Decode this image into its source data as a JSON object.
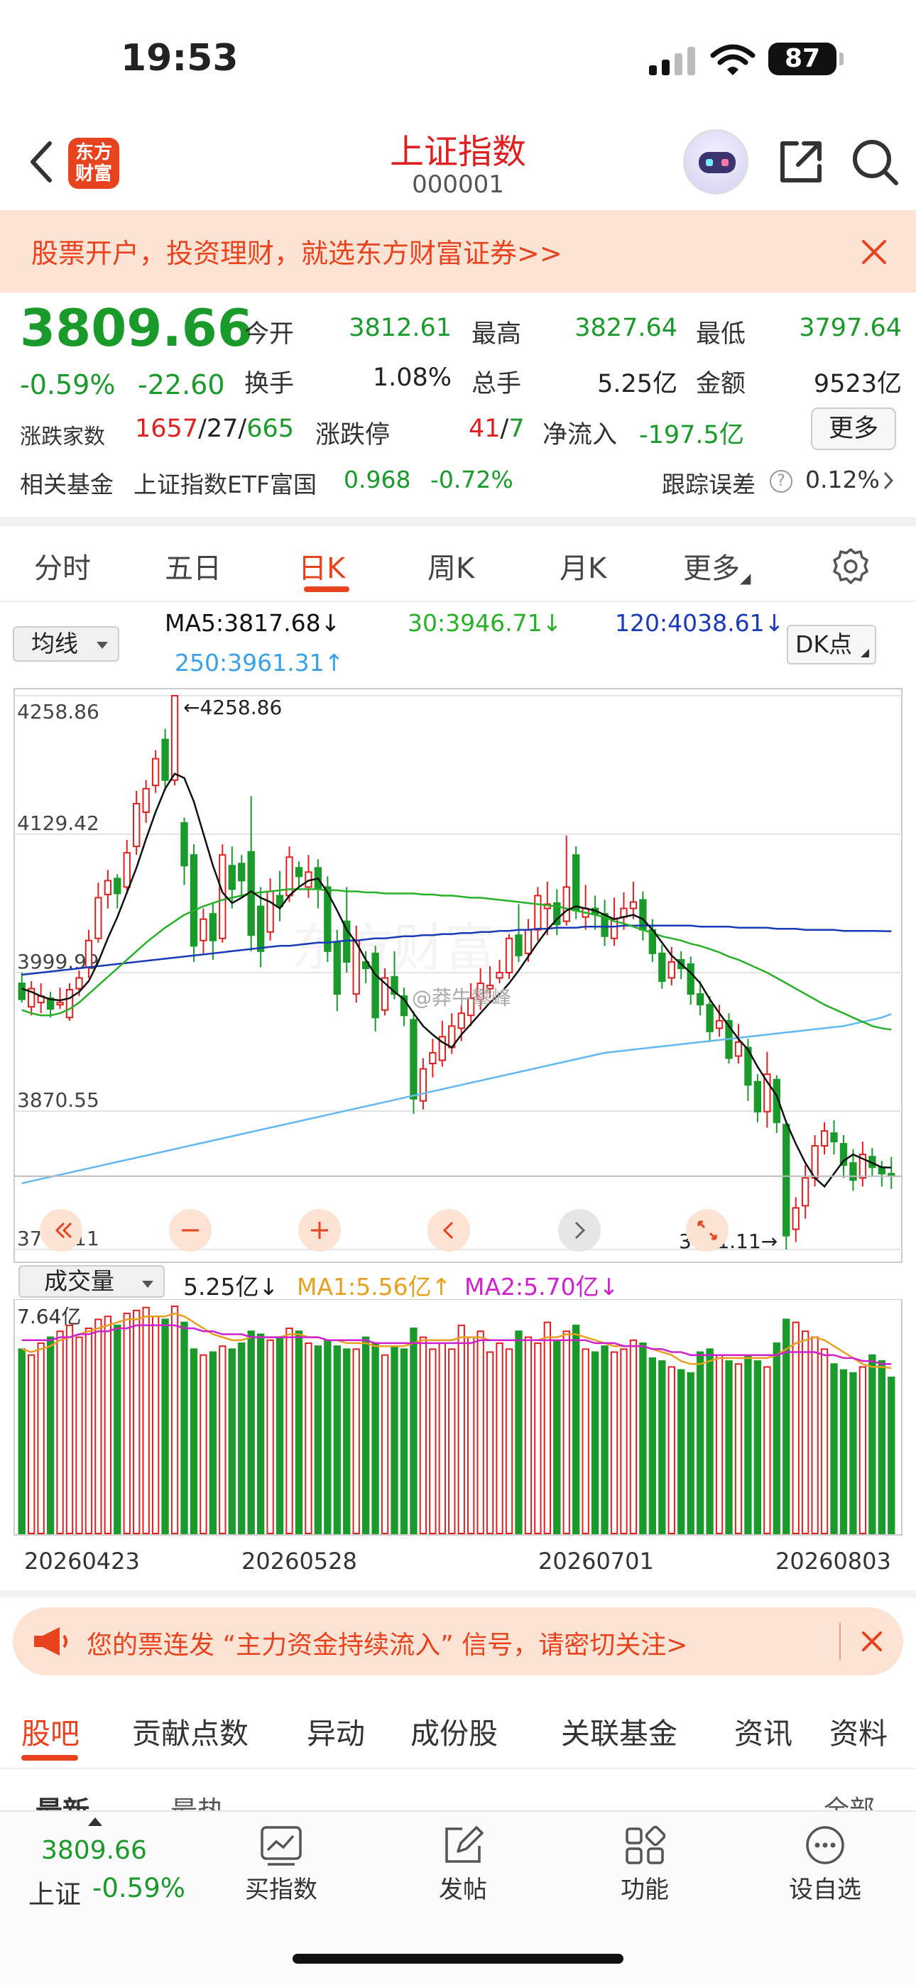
{
  "status": {
    "time": "19:53",
    "battery": "87"
  },
  "header": {
    "logo": "东方财富",
    "logo_line1": "东方",
    "logo_line2": "财富",
    "title": "上证指数",
    "code": "000001"
  },
  "promo": {
    "text": "股票开户，投资理财，就选东方财富证券>>"
  },
  "quote": {
    "price": "3809.66",
    "change_pct": "-0.59%",
    "change": "-22.60",
    "open_label": "今开",
    "open": "3812.61",
    "high_label": "最高",
    "high": "3827.64",
    "low_label": "最低",
    "low": "3797.64",
    "turnover_label": "换手",
    "turnover": "1.08%",
    "volume_label": "总手",
    "volume": "5.25亿",
    "amount_label": "金额",
    "amount": "9523亿",
    "breadth_label": "涨跌家数",
    "up_count": "1657",
    "flat_count": "27",
    "down_count": "665",
    "limit_label": "涨跌停",
    "limit_up": "41",
    "limit_down": "7",
    "inflow_label": "净流入",
    "inflow": "-197.5亿",
    "more_label": "更多",
    "fund_label": "相关基金",
    "fund_name": "上证指数ETF富国",
    "fund_price": "0.968",
    "fund_pct": "-0.72%",
    "tracking_label": "跟踪误差",
    "tracking_value": "0.12%"
  },
  "period_tabs": [
    "分时",
    "五日",
    "日K",
    "周K",
    "月K",
    "更多"
  ],
  "active_period": "日K",
  "ma": {
    "select_label": "均线",
    "ma5": "MA5:3817.68↓",
    "ma30": "30:3946.71↓",
    "ma120": "120:4038.61↓",
    "ma250": "250:3961.31↑",
    "dk_label": "DK点"
  },
  "colors": {
    "up": "#e02020",
    "down": "#1a9a2a",
    "ma5": "#111111",
    "ma30": "#28b028",
    "ma120": "#1a3ab8",
    "ma250": "#62b8f0",
    "accent": "#e8431f"
  },
  "chart_data": {
    "type": "candlestick",
    "y_ticks": [
      "4258.86",
      "4129.42",
      "3999.99",
      "3870.55",
      "3741.11"
    ],
    "ylim": [
      3741.11,
      4258.86
    ],
    "max_marker": "←4258.86",
    "min_marker": "3741.11→",
    "candles": [
      [
        3990,
        3975,
        4000,
        3972
      ],
      [
        3968,
        3985,
        3992,
        3960
      ],
      [
        3972,
        3978,
        3990,
        3962
      ],
      [
        3976,
        3966,
        3982,
        3958
      ],
      [
        3970,
        3972,
        3986,
        3966
      ],
      [
        3958,
        3984,
        3990,
        3955
      ],
      [
        3985,
        3995,
        4002,
        3978
      ],
      [
        4005,
        4030,
        4040,
        3995
      ],
      [
        4032,
        4070,
        4084,
        4028
      ],
      [
        4073,
        4086,
        4096,
        4060
      ],
      [
        4088,
        4074,
        4092,
        4060
      ],
      [
        4080,
        4112,
        4124,
        4074
      ],
      [
        4118,
        4158,
        4170,
        4110
      ],
      [
        4150,
        4172,
        4180,
        4140
      ],
      [
        4175,
        4200,
        4208,
        4168
      ],
      [
        4218,
        4180,
        4228,
        4170
      ],
      [
        4180,
        4258.86,
        4258.86,
        4175
      ],
      [
        4140,
        4100,
        4145,
        4082
      ],
      [
        4110,
        4025,
        4120,
        4010
      ],
      [
        4030,
        4050,
        4060,
        4018
      ],
      [
        4055,
        4030,
        4065,
        4012
      ],
      [
        4032,
        4110,
        4120,
        4028
      ],
      [
        4100,
        4078,
        4118,
        4060
      ],
      [
        4102,
        4086,
        4110,
        4070
      ],
      [
        4113,
        4035,
        4165,
        4020
      ],
      [
        4062,
        4020,
        4080,
        4005
      ],
      [
        4038,
        4076,
        4088,
        4030
      ],
      [
        4072,
        4062,
        4095,
        4048
      ],
      [
        4072,
        4108,
        4118,
        4066
      ],
      [
        4098,
        4090,
        4104,
        4080
      ],
      [
        4080,
        4094,
        4110,
        4070
      ],
      [
        4098,
        4078,
        4106,
        4060
      ],
      [
        4080,
        4020,
        4090,
        4010
      ],
      [
        4028,
        3980,
        4040,
        3964
      ],
      [
        4048,
        4010,
        4080,
        4000
      ],
      [
        3980,
        4030,
        4044,
        3972
      ],
      [
        4010,
        4004,
        4020,
        3990
      ],
      [
        4018,
        3958,
        4025,
        3945
      ],
      [
        3965,
        3995,
        4004,
        3960
      ],
      [
        3996,
        3980,
        4020,
        3975
      ],
      [
        3978,
        3960,
        3986,
        3950
      ],
      [
        3956,
        3882,
        3964,
        3868
      ],
      [
        3880,
        3910,
        3920,
        3872
      ],
      [
        3915,
        3925,
        3938,
        3902
      ],
      [
        3918,
        3940,
        3955,
        3912
      ],
      [
        3930,
        3950,
        3962,
        3924
      ],
      [
        3948,
        3962,
        3970,
        3936
      ],
      [
        3960,
        3976,
        3990,
        3950
      ],
      [
        3975,
        3990,
        4004,
        3965
      ],
      [
        3985,
        3988,
        4006,
        3976
      ],
      [
        3995,
        4000,
        4012,
        3990
      ],
      [
        4000,
        4032,
        4036,
        3994
      ],
      [
        4035,
        4016,
        4064,
        4010
      ],
      [
        4018,
        4040,
        4050,
        4010
      ],
      [
        4040,
        4072,
        4080,
        4030
      ],
      [
        4060,
        4064,
        4085,
        4035
      ],
      [
        4065,
        4045,
        4078,
        4035
      ],
      [
        4048,
        4080,
        4128,
        4044
      ],
      [
        4110,
        4058,
        4118,
        4050
      ],
      [
        4052,
        4060,
        4082,
        4040
      ],
      [
        4060,
        4055,
        4072,
        4040
      ],
      [
        4055,
        4034,
        4068,
        4025
      ],
      [
        4032,
        4050,
        4070,
        4025
      ],
      [
        4052,
        4060,
        4075,
        4040
      ],
      [
        4060,
        4066,
        4085,
        4050
      ],
      [
        4068,
        4040,
        4076,
        4030
      ],
      [
        4040,
        4018,
        4050,
        4010
      ],
      [
        4018,
        3992,
        4026,
        3985
      ],
      [
        3995,
        4010,
        4024,
        3988
      ],
      [
        4012,
        4004,
        4020,
        3994
      ],
      [
        4008,
        3980,
        4015,
        3970
      ],
      [
        3980,
        3970,
        3992,
        3960
      ],
      [
        3970,
        3945,
        3978,
        3935
      ],
      [
        3948,
        3955,
        3970,
        3940
      ],
      [
        3955,
        3920,
        3962,
        3915
      ],
      [
        3922,
        3935,
        3952,
        3915
      ],
      [
        3930,
        3895,
        3938,
        3880
      ],
      [
        3898,
        3870,
        3905,
        3860
      ],
      [
        3870,
        3905,
        3926,
        3855
      ],
      [
        3900,
        3860,
        3904,
        3850
      ],
      [
        3858,
        3754,
        3862,
        3741.11
      ],
      [
        3760,
        3780,
        3790,
        3748
      ],
      [
        3782,
        3808,
        3820,
        3770
      ],
      [
        3808,
        3838,
        3848,
        3800
      ],
      [
        3838,
        3852,
        3860,
        3830
      ],
      [
        3850,
        3842,
        3862,
        3830
      ],
      [
        3840,
        3820,
        3848,
        3808
      ],
      [
        3822,
        3806,
        3835,
        3796
      ],
      [
        3808,
        3830,
        3842,
        3800
      ],
      [
        3828,
        3818,
        3836,
        3810
      ],
      [
        3818,
        3812,
        3824,
        3800
      ],
      [
        3812,
        3809.66,
        3827.64,
        3797.64
      ]
    ],
    "ma5_line": [
      3985,
      3982,
      3978,
      3975,
      3974,
      3976,
      3982,
      3992,
      4010,
      4032,
      4052,
      4075,
      4098,
      4125,
      4150,
      4172,
      4186,
      4182,
      4160,
      4130,
      4100,
      4075,
      4065,
      4070,
      4076,
      4070,
      4066,
      4060,
      4072,
      4080,
      4086,
      4088,
      4075,
      4058,
      4040,
      4028,
      4012,
      3998,
      3990,
      3982,
      3975,
      3962,
      3950,
      3942,
      3935,
      3930,
      3942,
      3952,
      3962,
      3972,
      3980,
      3990,
      4002,
      4015,
      4028,
      4040,
      4050,
      4058,
      4062,
      4060,
      4058,
      4054,
      4050,
      4052,
      4054,
      4050,
      4040,
      4028,
      4016,
      4008,
      4000,
      3990,
      3975,
      3962,
      3950,
      3938,
      3928,
      3912,
      3898,
      3885,
      3860,
      3840,
      3822,
      3808,
      3800,
      3812,
      3824,
      3830,
      3826,
      3822,
      3818,
      3817.68
    ],
    "ma30_line": [
      3965,
      3962,
      3960,
      3960,
      3962,
      3966,
      3972,
      3980,
      3988,
      3996,
      4004,
      4012,
      4020,
      4028,
      4035,
      4042,
      4048,
      4054,
      4058,
      4062,
      4065,
      4068,
      4070,
      4072,
      4074,
      4075,
      4076,
      4077,
      4078,
      4078,
      4078,
      4078,
      4077,
      4077,
      4076,
      4076,
      4075,
      4075,
      4074,
      4074,
      4074,
      4074,
      4073,
      4073,
      4072,
      4072,
      4071,
      4070,
      4070,
      4069,
      4068,
      4067,
      4066,
      4065,
      4064,
      4063,
      4062,
      4060,
      4058,
      4056,
      4054,
      4052,
      4048,
      4046,
      4043,
      4040,
      4037,
      4034,
      4032,
      4030,
      4027,
      4025,
      4022,
      4019,
      4015,
      4012,
      4008,
      4004,
      4000,
      3995,
      3990,
      3985,
      3980,
      3975,
      3970,
      3966,
      3962,
      3958,
      3954,
      3950,
      3948,
      3946.71
    ],
    "ma120_line": [
      3998,
      3999,
      4000,
      4001,
      4002,
      4003,
      4004,
      4005,
      4006,
      4007,
      4008,
      4009,
      4010,
      4011,
      4012,
      4013,
      4014,
      4015,
      4016,
      4017,
      4018,
      4019,
      4020,
      4021,
      4022,
      4023,
      4024,
      4025,
      4025,
      4026,
      4027,
      4028,
      4028,
      4029,
      4030,
      4030,
      4031,
      4032,
      4032,
      4033,
      4034,
      4034,
      4035,
      4035,
      4036,
      4036,
      4037,
      4037,
      4038,
      4038,
      4039,
      4039,
      4040,
      4040,
      4041,
      4041,
      4042,
      4042,
      4042,
      4043,
      4043,
      4043,
      4043,
      4044,
      4044,
      4044,
      4044,
      4044,
      4044,
      4044,
      4044,
      4043,
      4043,
      4043,
      4043,
      4042,
      4042,
      4042,
      4042,
      4041,
      4041,
      4041,
      4040,
      4040,
      4040,
      4040,
      4039,
      4039,
      4039,
      4039,
      4038.8,
      4038.61
    ],
    "ma250_line": [
      3803,
      3805,
      3807,
      3809,
      3811,
      3813,
      3815,
      3817,
      3819,
      3821,
      3823,
      3825,
      3827,
      3829,
      3831,
      3833,
      3835,
      3837,
      3839,
      3841,
      3843,
      3845,
      3847,
      3849,
      3851,
      3853,
      3855,
      3857,
      3859,
      3861,
      3863,
      3865,
      3867,
      3869,
      3871,
      3873,
      3875,
      3877,
      3879,
      3881,
      3883,
      3885,
      3887,
      3889,
      3891,
      3893,
      3895,
      3897,
      3899,
      3901,
      3903,
      3905,
      3907,
      3909,
      3911,
      3913,
      3915,
      3917,
      3919,
      3921,
      3923,
      3925,
      3926,
      3927,
      3928,
      3929,
      3930,
      3931,
      3932,
      3933,
      3934,
      3935,
      3936,
      3937,
      3938,
      3939,
      3940,
      3941,
      3942,
      3943,
      3944,
      3945,
      3946,
      3947,
      3948,
      3949,
      3950,
      3952,
      3954,
      3956,
      3958,
      3961.31
    ]
  },
  "volume": {
    "select_label": "成交量",
    "value": "5.25亿↓",
    "ma1": "MA1:5.56亿↑",
    "ma2": "MA2:5.70亿↓",
    "ymax_label": "7.64亿",
    "ymax": 7.64,
    "bars": [
      6.2,
      6.0,
      6.4,
      6.6,
      6.8,
      7.0,
      6.6,
      6.9,
      7.2,
      7.3,
      7.0,
      7.4,
      7.5,
      7.6,
      7.3,
      7.2,
      7.64,
      7.1,
      6.2,
      6.0,
      6.1,
      6.3,
      6.2,
      6.4,
      6.8,
      6.7,
      6.5,
      6.6,
      6.9,
      6.8,
      6.4,
      6.3,
      6.5,
      6.3,
      6.2,
      6.2,
      6.6,
      6.4,
      6.0,
      6.3,
      6.2,
      6.9,
      6.6,
      6.2,
      6.4,
      6.2,
      7.0,
      6.6,
      6.8,
      6.1,
      6.4,
      6.2,
      6.8,
      6.6,
      6.4,
      7.1,
      6.5,
      6.8,
      7.0,
      6.2,
      6.1,
      6.3,
      6.1,
      6.2,
      6.5,
      6.4,
      5.9,
      5.8,
      5.6,
      5.5,
      5.4,
      6.1,
      6.2,
      6.0,
      5.8,
      5.7,
      6.0,
      5.8,
      5.6,
      6.4,
      7.2,
      7.1,
      6.8,
      6.6,
      6.2,
      5.7,
      5.5,
      5.4,
      5.6,
      6.0,
      5.8,
      5.25
    ],
    "ma1_line": [
      6.2,
      6.1,
      6.2,
      6.3,
      6.5,
      6.6,
      6.7,
      6.8,
      6.9,
      7.0,
      7.1,
      7.2,
      7.2,
      7.3,
      7.3,
      7.3,
      7.4,
      7.3,
      7.1,
      6.9,
      6.7,
      6.6,
      6.5,
      6.5,
      6.6,
      6.6,
      6.6,
      6.6,
      6.7,
      6.7,
      6.6,
      6.6,
      6.5,
      6.5,
      6.4,
      6.4,
      6.4,
      6.3,
      6.3,
      6.3,
      6.3,
      6.4,
      6.5,
      6.5,
      6.5,
      6.5,
      6.6,
      6.6,
      6.6,
      6.5,
      6.5,
      6.5,
      6.5,
      6.5,
      6.5,
      6.6,
      6.6,
      6.7,
      6.7,
      6.6,
      6.5,
      6.4,
      6.3,
      6.3,
      6.3,
      6.3,
      6.2,
      6.1,
      6.0,
      5.8,
      5.7,
      5.7,
      5.8,
      5.9,
      5.9,
      5.9,
      5.9,
      5.9,
      5.9,
      6.0,
      6.2,
      6.4,
      6.5,
      6.6,
      6.5,
      6.3,
      6.1,
      5.9,
      5.7,
      5.6,
      5.6,
      5.56
    ],
    "ma2_line": [
      6.5,
      6.5,
      6.5,
      6.5,
      6.6,
      6.6,
      6.7,
      6.7,
      6.8,
      6.8,
      6.9,
      6.9,
      7.0,
      7.0,
      7.0,
      7.0,
      7.0,
      6.9,
      6.9,
      6.8,
      6.8,
      6.7,
      6.7,
      6.7,
      6.6,
      6.6,
      6.6,
      6.6,
      6.6,
      6.6,
      6.6,
      6.6,
      6.5,
      6.5,
      6.5,
      6.5,
      6.5,
      6.4,
      6.4,
      6.4,
      6.4,
      6.4,
      6.4,
      6.4,
      6.4,
      6.4,
      6.4,
      6.4,
      6.5,
      6.5,
      6.5,
      6.5,
      6.5,
      6.5,
      6.5,
      6.5,
      6.5,
      6.5,
      6.5,
      6.5,
      6.4,
      6.4,
      6.4,
      6.3,
      6.3,
      6.3,
      6.2,
      6.2,
      6.1,
      6.1,
      6.0,
      6.0,
      6.0,
      6.0,
      6.0,
      6.0,
      6.0,
      6.0,
      6.0,
      6.0,
      6.1,
      6.1,
      6.1,
      6.1,
      6.0,
      6.0,
      5.9,
      5.9,
      5.8,
      5.8,
      5.7,
      5.7
    ]
  },
  "x_dates": [
    "20260423",
    "20260528",
    "20260701",
    "20260803"
  ],
  "alert": {
    "text": "您的票连发 “主力资金持续流入” 信号，请密切关注>"
  },
  "section_tabs": [
    "股吧",
    "贡献点数",
    "异动",
    "成份股",
    "关联基金",
    "资讯",
    "资料"
  ],
  "sub_tabs": {
    "latest": "最新",
    "hot": "最热",
    "all": "全部"
  },
  "bottom_bar": {
    "price": "3809.66",
    "name": "上证",
    "pct": "-0.59%",
    "items": [
      {
        "label": "买指数",
        "icon": "chart-icon"
      },
      {
        "label": "发帖",
        "icon": "edit-icon"
      },
      {
        "label": "功能",
        "icon": "grid-icon"
      },
      {
        "label": "设自选",
        "icon": "chat-dots-icon"
      }
    ]
  }
}
